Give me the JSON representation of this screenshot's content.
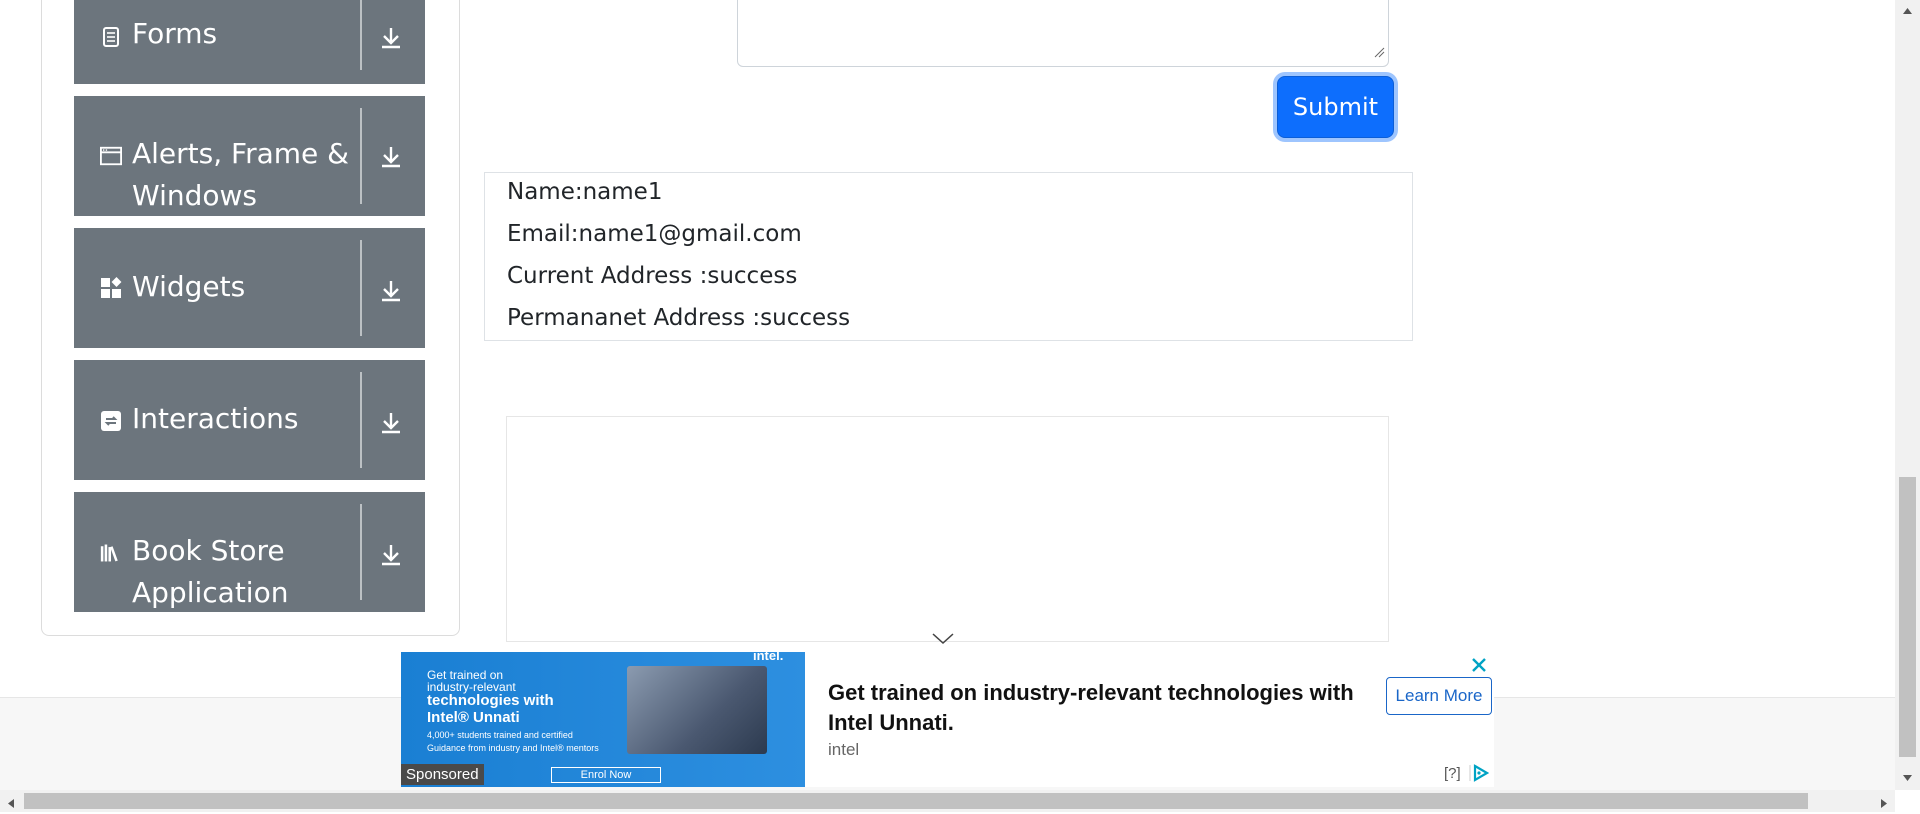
{
  "sidebar": {
    "groups": [
      {
        "label": "Forms",
        "icon": "document-icon"
      },
      {
        "label": "Alerts, Frame &",
        "label2": "Windows",
        "icon": "window-icon"
      },
      {
        "label": "Widgets",
        "icon": "widgets-icon"
      },
      {
        "label": "Interactions",
        "icon": "interactions-icon"
      },
      {
        "label": "Book Store",
        "label2": "Application",
        "icon": "books-icon"
      }
    ]
  },
  "form": {
    "submit_label": "Submit"
  },
  "output": {
    "name": "Name:name1",
    "email": "Email:name1@gmail.com",
    "current_address": "Current Address :success",
    "permanent_address": "Permananet Address :success"
  },
  "ad": {
    "headline": "Get trained on industry-relevant technologies with Intel Unnati.",
    "source": "intel",
    "cta": "Learn More",
    "sponsored": "Sponsored",
    "help": "[?]",
    "image_text": {
      "line1": "Get trained on",
      "line2": "industry-relevant",
      "line3": "technologies with",
      "line4": "Intel® Unnati",
      "line5": "4,000+ students trained and certified",
      "line6": "Guidance from industry and Intel® mentors",
      "button": "Enrol Now",
      "brand": "intel."
    }
  },
  "colors": {
    "sidebar_group_bg": "#6c757d",
    "primary_button": "#0d6efd",
    "ad_link": "#1a66c8",
    "ad_close": "#00a3c4"
  }
}
